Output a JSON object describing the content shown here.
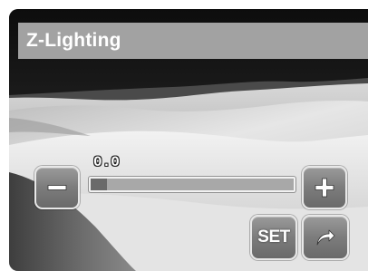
{
  "screen": {
    "title": "Z-Lighting"
  },
  "adjustment": {
    "value_text": "0.0",
    "level_fraction": 0.08
  },
  "buttons": {
    "minus_icon": "minus-icon",
    "plus_icon": "plus-icon",
    "set_label": "SET",
    "next_icon": "forward-arrow-icon"
  },
  "colors": {
    "title_bar": "#afafaf",
    "button_fill": "#7c7c7c",
    "button_border": "#e8e8e8",
    "slider_track": "#a8a8a8",
    "slider_fill": "#6a6a6a"
  }
}
